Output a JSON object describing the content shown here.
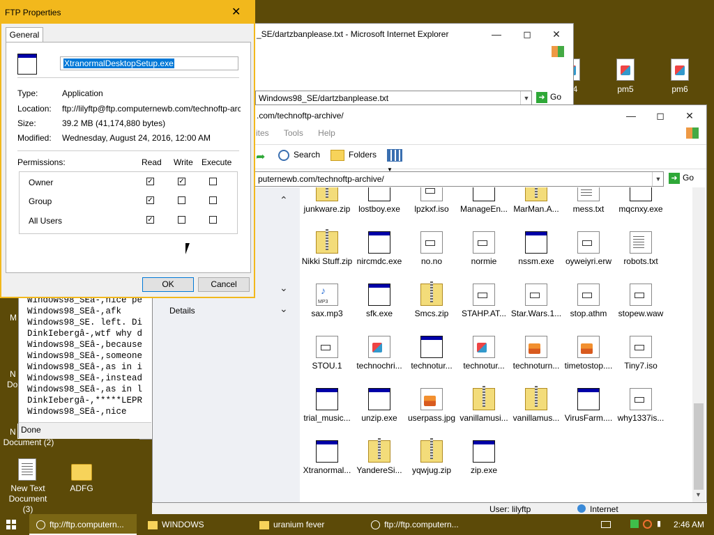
{
  "desktop": {
    "icons": [
      {
        "label": "pm5"
      },
      {
        "label": "pm6"
      },
      {
        "label": "4"
      },
      {
        "label": "New Text Document (3)"
      },
      {
        "label": "ADFG"
      },
      {
        "label": "Document (2)"
      }
    ],
    "partial_labels": [
      "M",
      "N",
      "Do",
      "N"
    ]
  },
  "ie_window": {
    "title": "_SE/dartzbanplease.txt - Microsoft Internet Explorer",
    "address": "Windows98_SE/dartzbanplease.txt",
    "go_label": "Go",
    "status": "Done",
    "console_lines": [
      "Windows98_SEâ-,nice pe",
      "Windows98_SEâ-,afk",
      "Windows98_SE. left. Di",
      "DinkIebergâ-,wtf why d",
      "Windows98_SEâ-,because",
      "Windows98_SEâ-,someone",
      "Windows98_SEâ-,as in i",
      "Windows98_SEâ-,instead",
      "Windows98_SEâ-,as in l",
      "DinkIebergâ-,*****LEPR",
      "Windows98_SEâ-,nice"
    ]
  },
  "explorer": {
    "title": ".com/technoftp-archive/",
    "menu": [
      "ites",
      "Tools",
      "Help"
    ],
    "toolbar": {
      "search": "Search",
      "folders": "Folders"
    },
    "address": "puternewb.com/technoftp-archive/",
    "go_label": "Go",
    "pane": {
      "details": "Details"
    },
    "status_user": "User: lilyftp",
    "status_zone": "Internet",
    "files": [
      {
        "name": "junkware.zip",
        "icon": "zip"
      },
      {
        "name": "lostboy.exe",
        "icon": "exe"
      },
      {
        "name": "lpzkxf.iso",
        "icon": "file"
      },
      {
        "name": "ManageEn...",
        "icon": "exe"
      },
      {
        "name": "MarMan.A...",
        "icon": "zip"
      },
      {
        "name": "mess.txt",
        "icon": "doc"
      },
      {
        "name": "mqcnxy.exe",
        "icon": "exe"
      },
      {
        "name": "Nikki Stuff.zip",
        "icon": "zip"
      },
      {
        "name": "nircmdc.exe",
        "icon": "exe"
      },
      {
        "name": "no.no",
        "icon": "file"
      },
      {
        "name": "normie",
        "icon": "file"
      },
      {
        "name": "nssm.exe",
        "icon": "exe"
      },
      {
        "name": "oyweiyri.erw",
        "icon": "file"
      },
      {
        "name": "robots.txt",
        "icon": "doc"
      },
      {
        "name": "sax.mp3",
        "icon": "mp3"
      },
      {
        "name": "sfk.exe",
        "icon": "exe"
      },
      {
        "name": "Smcs.zip",
        "icon": "zip"
      },
      {
        "name": "STAHP.AT...",
        "icon": "file"
      },
      {
        "name": "Star.Wars.1...",
        "icon": "file"
      },
      {
        "name": "stop.athm",
        "icon": "file"
      },
      {
        "name": "stopew.waw",
        "icon": "file"
      },
      {
        "name": "STOU.1",
        "icon": "file"
      },
      {
        "name": "technochri...",
        "icon": "web"
      },
      {
        "name": "technotur...",
        "icon": "exe"
      },
      {
        "name": "technotur...",
        "icon": "web"
      },
      {
        "name": "technoturn...",
        "icon": "img"
      },
      {
        "name": "timetostop....",
        "icon": "img"
      },
      {
        "name": "Tiny7.iso",
        "icon": "file"
      },
      {
        "name": "trial_music...",
        "icon": "exe"
      },
      {
        "name": "unzip.exe",
        "icon": "exe"
      },
      {
        "name": "userpass.jpg",
        "icon": "img"
      },
      {
        "name": "vanillamusi...",
        "icon": "zip"
      },
      {
        "name": "vanillamus...",
        "icon": "zip"
      },
      {
        "name": "VirusFarm....",
        "icon": "exe"
      },
      {
        "name": "why1337is...",
        "icon": "file"
      },
      {
        "name": "Xtranormal...",
        "icon": "exe"
      },
      {
        "name": "YandereSi...",
        "icon": "zip"
      },
      {
        "name": "yqwjug.zip",
        "icon": "zip"
      },
      {
        "name": "zip.exe",
        "icon": "exe"
      }
    ]
  },
  "dialog": {
    "title": "FTP Properties",
    "tab": "General",
    "filename": "XtranormalDesktopSetup.exe",
    "type_label": "Type:",
    "type_value": "Application",
    "location_label": "Location:",
    "location_value": "ftp://lilyftp@ftp.computernewb.com/technoftp-archiv",
    "size_label": "Size:",
    "size_value": "39.2 MB (41,174,880 bytes)",
    "modified_label": "Modified:",
    "modified_value": "Wednesday, August 24, 2016, 12:00 AM",
    "permissions_label": "Permissions:",
    "col_read": "Read",
    "col_write": "Write",
    "col_execute": "Execute",
    "rows": [
      {
        "name": "Owner",
        "read": true,
        "write": true,
        "execute": false
      },
      {
        "name": "Group",
        "read": true,
        "write": false,
        "execute": false
      },
      {
        "name": "All Users",
        "read": true,
        "write": false,
        "execute": false
      }
    ],
    "ok": "OK",
    "cancel": "Cancel",
    "accent": "#f2b81c"
  },
  "taskbar": {
    "items": [
      {
        "label": "ftp://ftp.computern...",
        "icon": "ftp-icon"
      },
      {
        "label": "WINDOWS",
        "icon": "folder-icon"
      },
      {
        "label": "uranium fever",
        "icon": "folder-icon"
      },
      {
        "label": "ftp://ftp.computern...",
        "icon": "ftp-icon"
      }
    ],
    "time": "2:46 AM",
    "color": "#5c4a08"
  }
}
